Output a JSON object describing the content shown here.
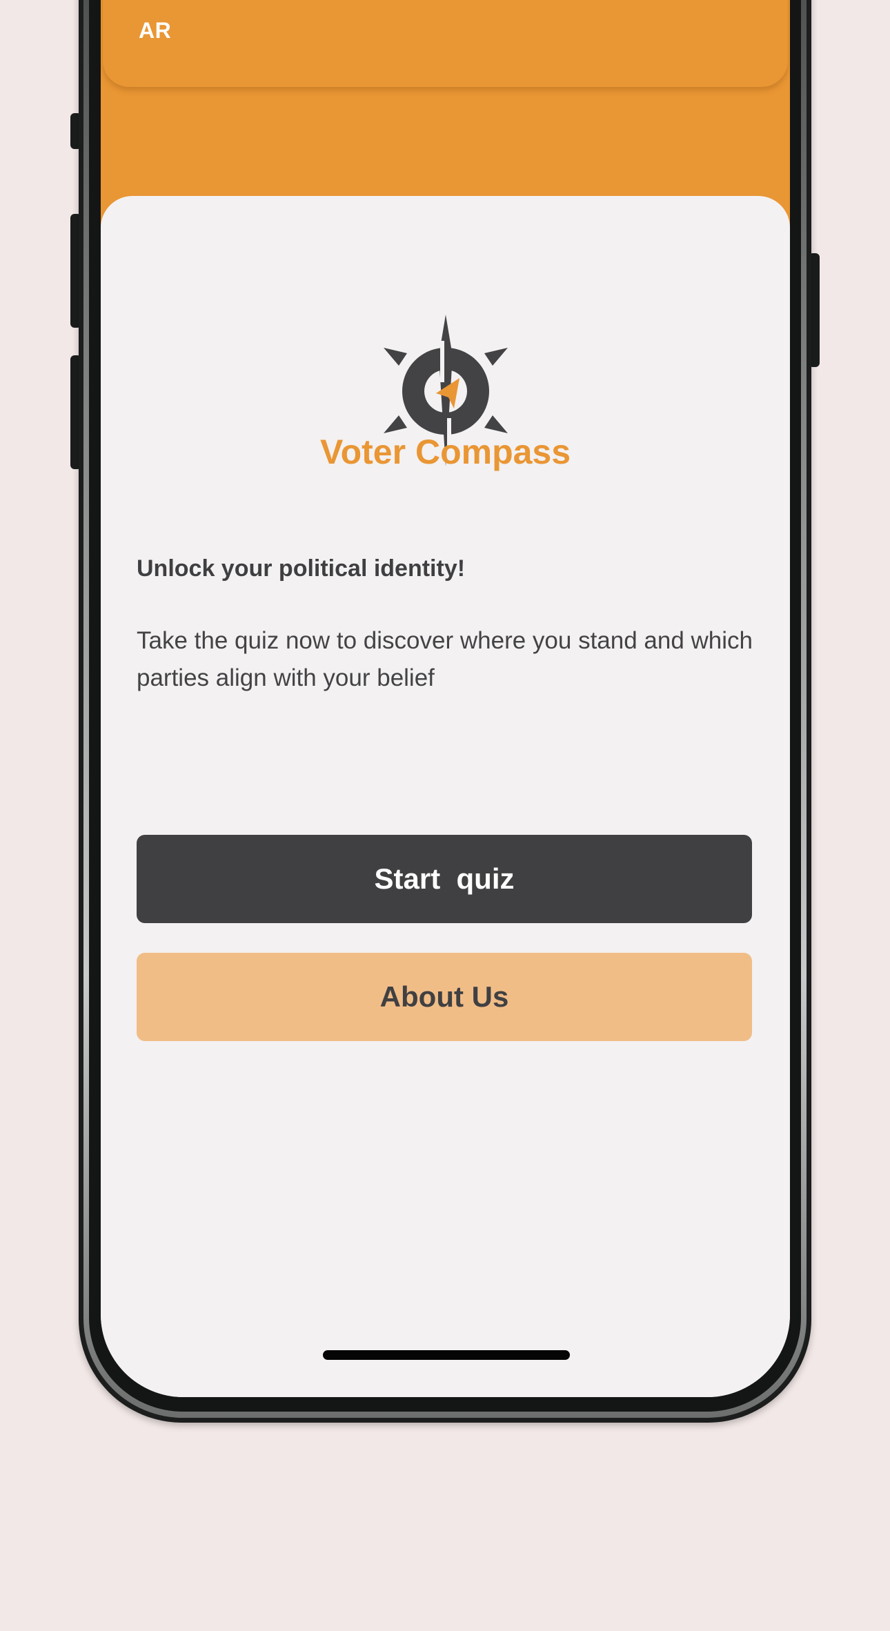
{
  "header": {
    "language_toggle": "AR"
  },
  "app": {
    "name": "Voter Compass",
    "logo_icon": "compass-logo-icon"
  },
  "intro": {
    "tagline": "Unlock your political identity!",
    "description": "Take the quiz now to discover where you stand and which parties align with your belief"
  },
  "actions": {
    "start_quiz_label": "Start  quiz",
    "about_us_label": "About Us"
  },
  "colors": {
    "brand_orange": "#e99634",
    "dark_button": "#404042",
    "light_orange_button": "#f1bd87",
    "background": "#f3f1f2"
  }
}
